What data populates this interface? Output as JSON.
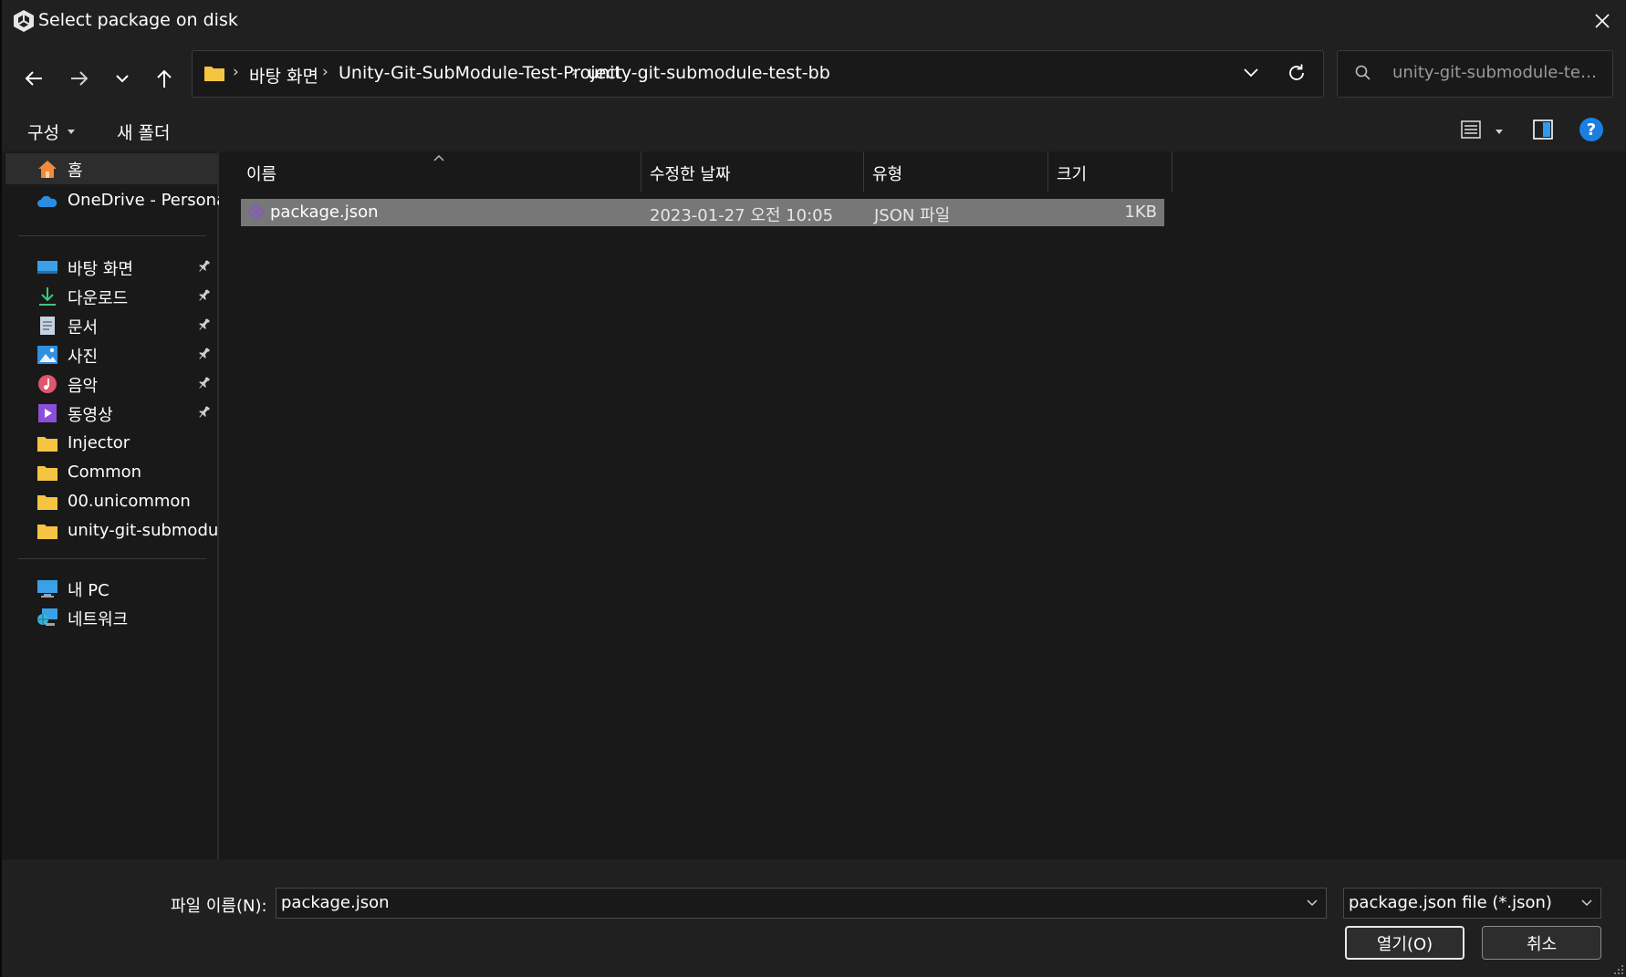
{
  "window": {
    "title": "Select package on disk",
    "close_label": "×"
  },
  "nav": {
    "breadcrumbs": [
      "바탕 화면",
      "Unity-Git-SubModule-Test-Project",
      "unity-git-submodule-test-bb"
    ],
    "search_placeholder": "unity-git-submodule-test-b..."
  },
  "commands": {
    "organize": "구성",
    "new_folder": "새 폴더",
    "help": "?"
  },
  "sidebar": {
    "home": "홈",
    "onedrive": "OneDrive - Personal",
    "quick_access": [
      {
        "label": "바탕 화면",
        "icon": "desktop-icon"
      },
      {
        "label": "다운로드",
        "icon": "download-icon"
      },
      {
        "label": "문서",
        "icon": "documents-icon"
      },
      {
        "label": "사진",
        "icon": "pictures-icon"
      },
      {
        "label": "음악",
        "icon": "music-icon"
      },
      {
        "label": "동영상",
        "icon": "videos-icon"
      }
    ],
    "folders": [
      "Injector",
      "Common",
      "00.unicommon",
      "unity-git-submodule"
    ],
    "this_pc": "내 PC",
    "network": "네트워크"
  },
  "columns": {
    "name": "이름",
    "modified": "수정한 날짜",
    "type": "유형",
    "size": "크기"
  },
  "files": [
    {
      "name": "package.json",
      "modified": "2023-01-27 오전 10:05",
      "type": "JSON 파일",
      "size": "1KB"
    }
  ],
  "bottom": {
    "filename_label": "파일 이름(N):",
    "filename_value": "package.json",
    "filetype_value": "package.json file (*.json)",
    "open_label": "열기(O)",
    "cancel_label": "취소"
  },
  "colors": {
    "accent": "#1a7fe0",
    "folder": "#f5c542",
    "selection": "#777777",
    "background": "#191919"
  }
}
